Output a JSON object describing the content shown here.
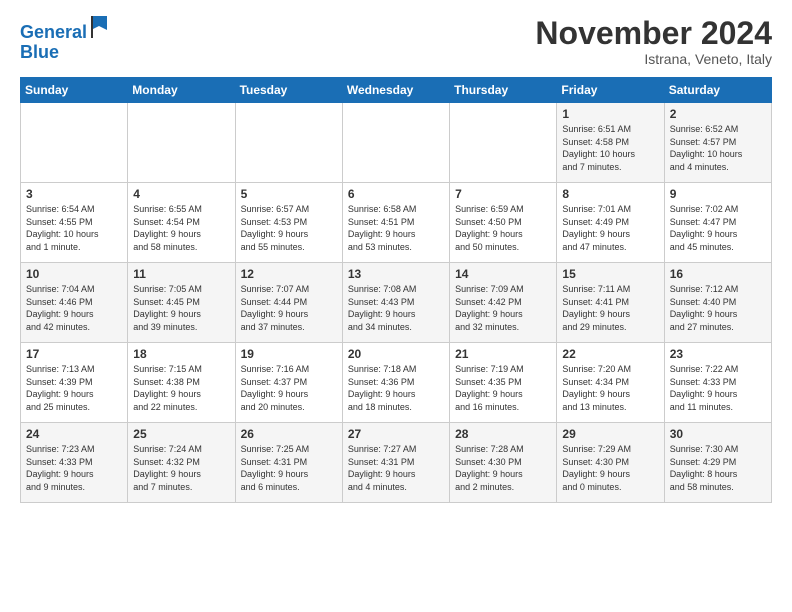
{
  "header": {
    "logo_line1": "General",
    "logo_line2": "Blue",
    "month_title": "November 2024",
    "location": "Istrana, Veneto, Italy"
  },
  "days_of_week": [
    "Sunday",
    "Monday",
    "Tuesday",
    "Wednesday",
    "Thursday",
    "Friday",
    "Saturday"
  ],
  "weeks": [
    [
      {
        "day": "",
        "info": ""
      },
      {
        "day": "",
        "info": ""
      },
      {
        "day": "",
        "info": ""
      },
      {
        "day": "",
        "info": ""
      },
      {
        "day": "",
        "info": ""
      },
      {
        "day": "1",
        "info": "Sunrise: 6:51 AM\nSunset: 4:58 PM\nDaylight: 10 hours\nand 7 minutes."
      },
      {
        "day": "2",
        "info": "Sunrise: 6:52 AM\nSunset: 4:57 PM\nDaylight: 10 hours\nand 4 minutes."
      }
    ],
    [
      {
        "day": "3",
        "info": "Sunrise: 6:54 AM\nSunset: 4:55 PM\nDaylight: 10 hours\nand 1 minute."
      },
      {
        "day": "4",
        "info": "Sunrise: 6:55 AM\nSunset: 4:54 PM\nDaylight: 9 hours\nand 58 minutes."
      },
      {
        "day": "5",
        "info": "Sunrise: 6:57 AM\nSunset: 4:53 PM\nDaylight: 9 hours\nand 55 minutes."
      },
      {
        "day": "6",
        "info": "Sunrise: 6:58 AM\nSunset: 4:51 PM\nDaylight: 9 hours\nand 53 minutes."
      },
      {
        "day": "7",
        "info": "Sunrise: 6:59 AM\nSunset: 4:50 PM\nDaylight: 9 hours\nand 50 minutes."
      },
      {
        "day": "8",
        "info": "Sunrise: 7:01 AM\nSunset: 4:49 PM\nDaylight: 9 hours\nand 47 minutes."
      },
      {
        "day": "9",
        "info": "Sunrise: 7:02 AM\nSunset: 4:47 PM\nDaylight: 9 hours\nand 45 minutes."
      }
    ],
    [
      {
        "day": "10",
        "info": "Sunrise: 7:04 AM\nSunset: 4:46 PM\nDaylight: 9 hours\nand 42 minutes."
      },
      {
        "day": "11",
        "info": "Sunrise: 7:05 AM\nSunset: 4:45 PM\nDaylight: 9 hours\nand 39 minutes."
      },
      {
        "day": "12",
        "info": "Sunrise: 7:07 AM\nSunset: 4:44 PM\nDaylight: 9 hours\nand 37 minutes."
      },
      {
        "day": "13",
        "info": "Sunrise: 7:08 AM\nSunset: 4:43 PM\nDaylight: 9 hours\nand 34 minutes."
      },
      {
        "day": "14",
        "info": "Sunrise: 7:09 AM\nSunset: 4:42 PM\nDaylight: 9 hours\nand 32 minutes."
      },
      {
        "day": "15",
        "info": "Sunrise: 7:11 AM\nSunset: 4:41 PM\nDaylight: 9 hours\nand 29 minutes."
      },
      {
        "day": "16",
        "info": "Sunrise: 7:12 AM\nSunset: 4:40 PM\nDaylight: 9 hours\nand 27 minutes."
      }
    ],
    [
      {
        "day": "17",
        "info": "Sunrise: 7:13 AM\nSunset: 4:39 PM\nDaylight: 9 hours\nand 25 minutes."
      },
      {
        "day": "18",
        "info": "Sunrise: 7:15 AM\nSunset: 4:38 PM\nDaylight: 9 hours\nand 22 minutes."
      },
      {
        "day": "19",
        "info": "Sunrise: 7:16 AM\nSunset: 4:37 PM\nDaylight: 9 hours\nand 20 minutes."
      },
      {
        "day": "20",
        "info": "Sunrise: 7:18 AM\nSunset: 4:36 PM\nDaylight: 9 hours\nand 18 minutes."
      },
      {
        "day": "21",
        "info": "Sunrise: 7:19 AM\nSunset: 4:35 PM\nDaylight: 9 hours\nand 16 minutes."
      },
      {
        "day": "22",
        "info": "Sunrise: 7:20 AM\nSunset: 4:34 PM\nDaylight: 9 hours\nand 13 minutes."
      },
      {
        "day": "23",
        "info": "Sunrise: 7:22 AM\nSunset: 4:33 PM\nDaylight: 9 hours\nand 11 minutes."
      }
    ],
    [
      {
        "day": "24",
        "info": "Sunrise: 7:23 AM\nSunset: 4:33 PM\nDaylight: 9 hours\nand 9 minutes."
      },
      {
        "day": "25",
        "info": "Sunrise: 7:24 AM\nSunset: 4:32 PM\nDaylight: 9 hours\nand 7 minutes."
      },
      {
        "day": "26",
        "info": "Sunrise: 7:25 AM\nSunset: 4:31 PM\nDaylight: 9 hours\nand 6 minutes."
      },
      {
        "day": "27",
        "info": "Sunrise: 7:27 AM\nSunset: 4:31 PM\nDaylight: 9 hours\nand 4 minutes."
      },
      {
        "day": "28",
        "info": "Sunrise: 7:28 AM\nSunset: 4:30 PM\nDaylight: 9 hours\nand 2 minutes."
      },
      {
        "day": "29",
        "info": "Sunrise: 7:29 AM\nSunset: 4:30 PM\nDaylight: 9 hours\nand 0 minutes."
      },
      {
        "day": "30",
        "info": "Sunrise: 7:30 AM\nSunset: 4:29 PM\nDaylight: 8 hours\nand 58 minutes."
      }
    ]
  ]
}
